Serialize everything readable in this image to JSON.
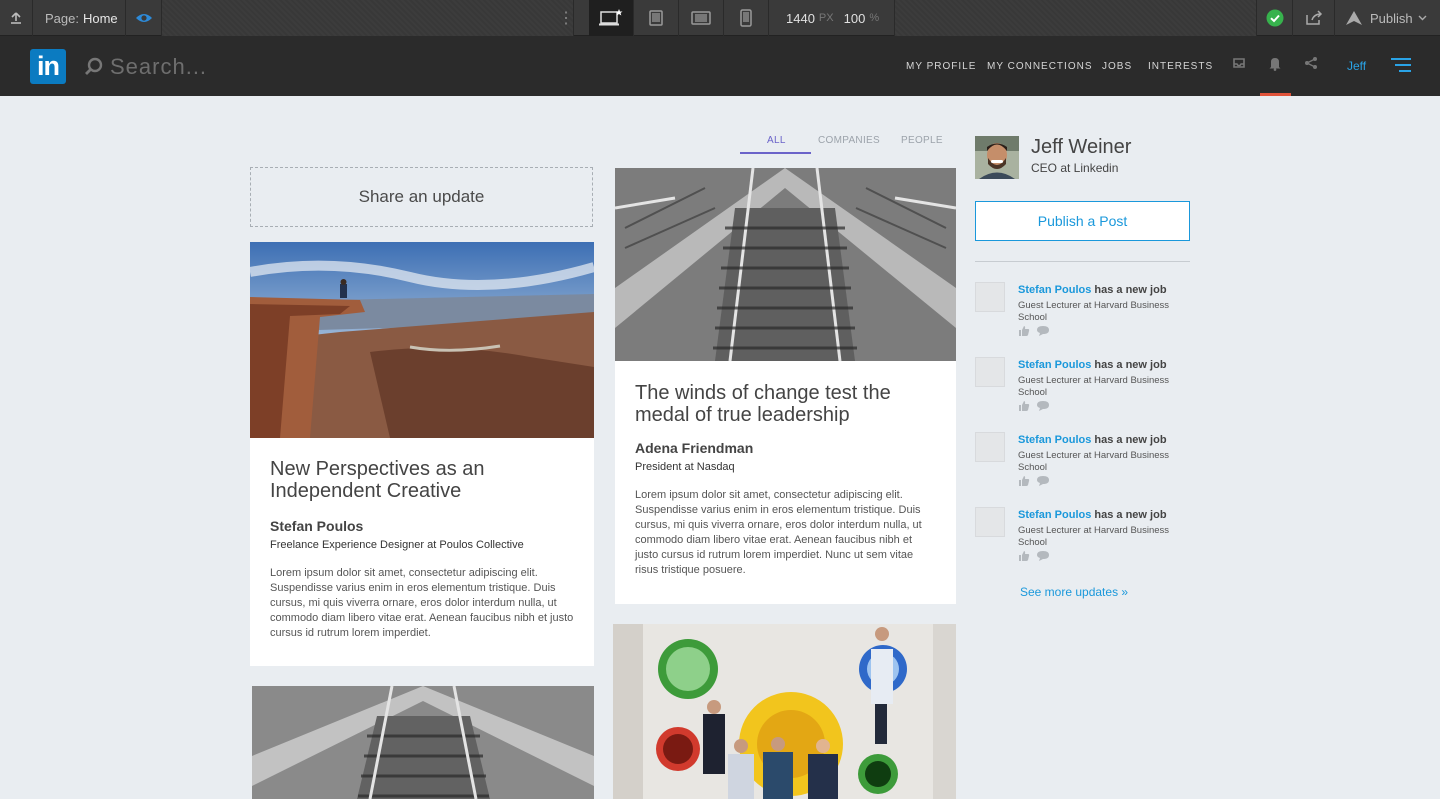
{
  "toolbar": {
    "page_label": "Page:",
    "page_value": "Home",
    "width_value": "1440",
    "width_unit": "PX",
    "zoom_value": "100",
    "zoom_unit": "%",
    "publish_label": "Publish"
  },
  "header": {
    "logo_text": "in",
    "search_placeholder": "Search...",
    "nav": [
      "MY PROFILE",
      "MY CONNECTIONS",
      "JOBS",
      "INTERESTS"
    ],
    "user_name": "Jeff",
    "accent_color": "#e0533a"
  },
  "feed": {
    "tabs": [
      "ALL",
      "COMPANIES",
      "PEOPLE"
    ],
    "active_tab": "ALL",
    "share_placeholder": "Share an update",
    "cards": [
      {
        "title": "New Perspectives as an Independent Creative",
        "author": "Stefan Poulos",
        "role": "Freelance Experience Designer at Poulos Collective",
        "excerpt": "Lorem ipsum dolor sit amet, consectetur adipiscing elit. Suspendisse varius enim in eros elementum tristique. Duis cursus, mi quis viverra ornare, eros dolor interdum nulla, ut commodo diam libero vitae erat. Aenean faucibus nibh et justo cursus id rutrum lorem imperdiet."
      },
      {
        "title": "The winds of change test the medal of true leadership",
        "author": "Adena Friendman",
        "role": "President at Nasdaq",
        "excerpt": "Lorem ipsum dolor sit amet, consectetur adipiscing elit. Suspendisse varius enim in eros elementum tristique. Duis cursus, mi quis viverra ornare, eros dolor interdum nulla, ut commodo diam libero vitae erat. Aenean faucibus nibh et justo cursus id rutrum lorem imperdiet. Nunc ut sem vitae risus tristique posuere."
      }
    ]
  },
  "sidebar": {
    "profile_name": "Jeff Weiner",
    "profile_title": "CEO at Linkedin",
    "publish_button": "Publish a Post",
    "updates": [
      {
        "who": "Stefan Poulos",
        "what": "has a new job",
        "desc": "Guest Lecturer at Harvard Business School"
      },
      {
        "who": "Stefan Poulos",
        "what": "has a new job",
        "desc": "Guest Lecturer at Harvard Business School"
      },
      {
        "who": "Stefan Poulos",
        "what": "has a new job",
        "desc": "Guest Lecturer at Harvard Business School"
      },
      {
        "who": "Stefan Poulos",
        "what": "has a new job",
        "desc": "Guest Lecturer at Harvard Business School"
      }
    ],
    "see_more": "See more updates »"
  }
}
